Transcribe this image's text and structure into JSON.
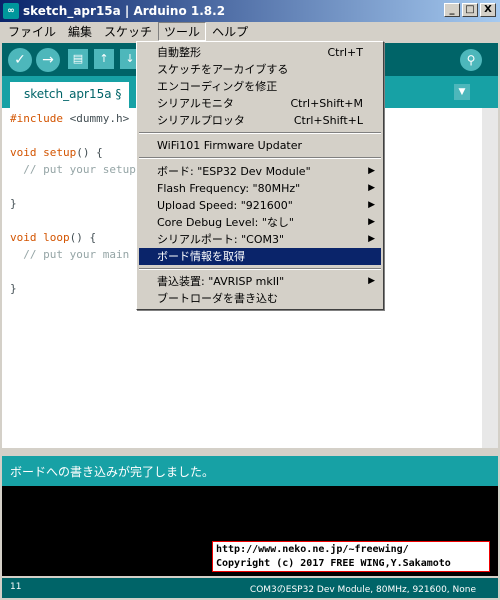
{
  "window": {
    "title": "sketch_apr15a | Arduino 1.8.2",
    "icon_glyph": "∞",
    "minimize": "_",
    "maximize": "□",
    "close": "X"
  },
  "menubar": {
    "items": [
      {
        "label": "ファイル"
      },
      {
        "label": "編集"
      },
      {
        "label": "スケッチ"
      },
      {
        "label": "ツール"
      },
      {
        "label": "ヘルプ"
      }
    ]
  },
  "toolbar": {
    "verify_icon": "✓",
    "upload_icon": "→",
    "new_icon": "▤",
    "open_icon": "↑",
    "save_icon": "↓",
    "serial_monitor_icon": "⚲"
  },
  "tabs": {
    "active": "sketch_apr15a §",
    "tab_menu_icon": "▼"
  },
  "code": {
    "lines": [
      {
        "keyword": "#include",
        "rest": " <dummy.h>"
      },
      {
        "keyword": "void",
        "func": " setup",
        "rest": "() {"
      },
      {
        "comment": "  // put your setup c"
      },
      {
        "rest": "}"
      },
      {
        "keyword": "void",
        "func": " loop",
        "rest": "() {"
      },
      {
        "comment": "  // put your main cc"
      },
      {
        "rest": "}"
      }
    ]
  },
  "console": {
    "status_message": "ボードへの書き込みが完了しました。",
    "credit_line1": "http://www.neko.ne.jp/~freewing/",
    "credit_line2": "Copyright (c) 2017 FREE WING,Y.Sakamoto"
  },
  "footer": {
    "line_number": "11",
    "board_info": "COM3のESP32 Dev Module, 80MHz, 921600, None"
  },
  "tools_menu": {
    "auto_format": "自動整形",
    "auto_format_shortcut": "Ctrl+T",
    "archive_sketch": "スケッチをアーカイブする",
    "fix_encoding": "エンコーディングを修正",
    "serial_monitor": "シリアルモニタ",
    "serial_monitor_shortcut": "Ctrl+Shift+M",
    "serial_plotter": "シリアルプロッタ",
    "serial_plotter_shortcut": "Ctrl+Shift+L",
    "wifi_updater": "WiFi101 Firmware Updater",
    "board": "ボード: \"ESP32 Dev Module\"",
    "flash_frequency": "Flash Frequency: \"80MHz\"",
    "upload_speed": "Upload Speed: \"921600\"",
    "core_debug": "Core Debug Level: \"なし\"",
    "serial_port": "シリアルポート: \"COM3\"",
    "board_info": "ボード情報を取得",
    "programmer": "書込装置: \"AVRISP mkII\"",
    "burn_bootloader": "ブートローダを書き込む",
    "submenu_arrow": "▶"
  }
}
